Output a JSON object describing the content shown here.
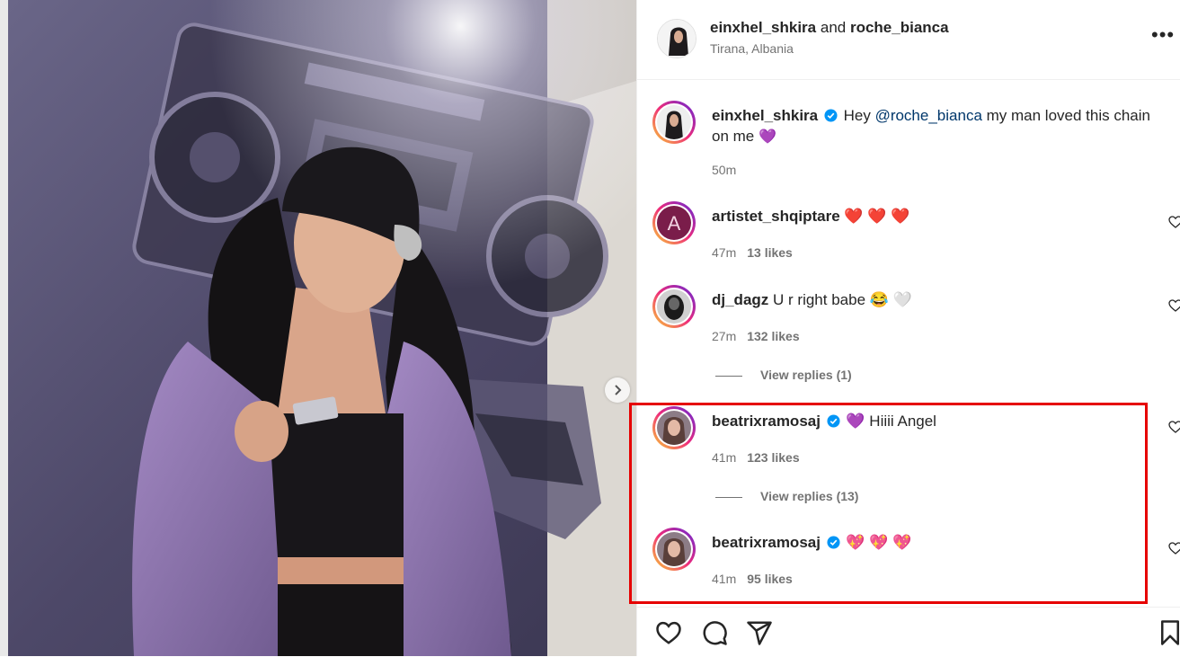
{
  "header": {
    "user1": "einxhel_shkira",
    "and": "and",
    "user2": "roche_bianca",
    "location": "Tirana, Albania",
    "more_label": "•••"
  },
  "caption": {
    "username": "einxhel_shkira",
    "text_before": "Hey ",
    "mention": "@roche_bianca",
    "text_after": " my man loved this chain on me",
    "emoji": "💜",
    "time": "50m"
  },
  "comments": [
    {
      "username": "artistet_shqiptare",
      "text": "❤️ ❤️ ❤️",
      "time": "47m",
      "likes": "13 likes"
    },
    {
      "username": "dj_dagz",
      "text": "U r right babe 😂 🤍",
      "time": "27m",
      "likes": "132 likes",
      "replies": "View replies (1)"
    },
    {
      "username": "beatrixramosaj",
      "text": "💜  Hiiii Angel",
      "time": "41m",
      "likes": "123 likes",
      "replies": "View replies (13)"
    },
    {
      "username": "beatrixramosaj",
      "text": "💖 💖 💖",
      "time": "41m",
      "likes": "95 likes"
    }
  ],
  "colors": {
    "highlight": "#e60000",
    "verified": "#0095f6",
    "mention": "#00376b"
  },
  "icons": [
    "heart-icon",
    "comment-icon",
    "share-icon",
    "bookmark-icon",
    "chevron-right-icon",
    "verified-icon"
  ]
}
